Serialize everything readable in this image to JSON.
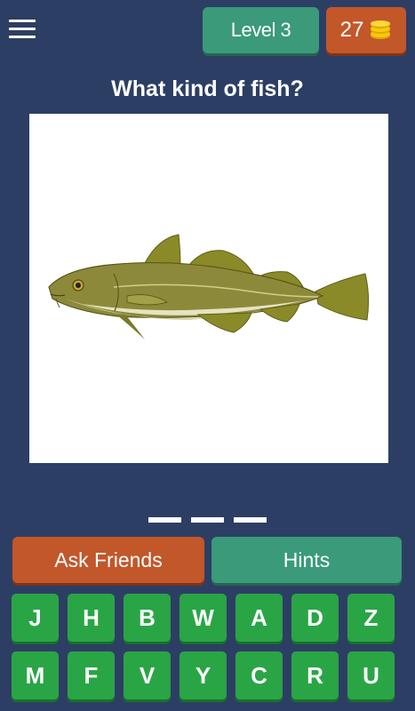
{
  "header": {
    "level_label": "Level 3",
    "coins": "27"
  },
  "question": "What kind of fish?",
  "image": {
    "subject_icon": "fish-illustration"
  },
  "answer_slots": 3,
  "buttons": {
    "ask_friends": "Ask Friends",
    "hints": "Hints"
  },
  "keyboard": {
    "row1": [
      "J",
      "H",
      "B",
      "W",
      "A",
      "D",
      "Z"
    ],
    "row2": [
      "M",
      "F",
      "V",
      "Y",
      "C",
      "R",
      "U"
    ]
  },
  "colors": {
    "background": "#2d3e64",
    "green_button": "#3a9a7a",
    "orange_button": "#c2572a",
    "key_green": "#2aa546"
  }
}
